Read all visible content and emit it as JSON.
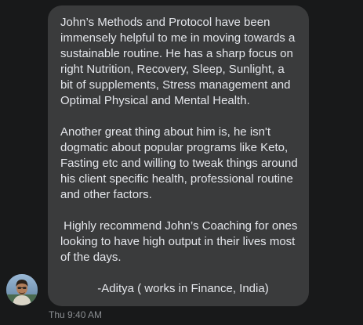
{
  "message": {
    "paragraphs": [
      "John’s Methods and Protocol have been immensely helpful to me in moving towards a sustainable routine. He has a sharp focus on right Nutrition, Recovery, Sleep, Sunlight, a bit of supplements, Stress management and Optimal Physical and Mental Health.",
      "Another great thing about him is, he isn't dogmatic about popular programs like Keto, Fasting etc and willing to tweak things around his client specific health, professional routine and other factors.",
      " Highly recommend John’s Coaching for ones looking to have high output in their lives most of the days."
    ],
    "signature": "-Aditya ( works in Finance, India)"
  },
  "sender": {
    "avatar_icon": "user-avatar-photo"
  },
  "timestamp": "Thu 9:40 AM",
  "colors": {
    "background": "#18191a",
    "bubble": "#3a3b3c",
    "text": "#e4e6eb",
    "timestamp": "#8a8d91"
  }
}
